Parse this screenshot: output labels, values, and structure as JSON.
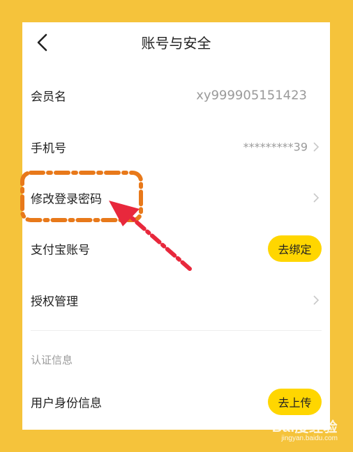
{
  "header": {
    "title": "账号与安全"
  },
  "rows": [
    {
      "label": "会员名",
      "value": "xy999905151423"
    },
    {
      "label": "手机号",
      "value": "*********39"
    },
    {
      "label": "修改登录密码"
    },
    {
      "label": "支付宝账号",
      "button": "去绑定"
    },
    {
      "label": "授权管理"
    }
  ],
  "section": {
    "title": "认证信息"
  },
  "identity_row": {
    "label": "用户身份信息",
    "button": "去上传"
  },
  "watermark": {
    "main": "Bai度经验",
    "sub": "jingyan.baidu.com"
  },
  "colors": {
    "background": "#f5c33b",
    "pill": "#ffd600",
    "annotation_box": "#e8791a",
    "annotation_arrow": "#e8283c"
  },
  "icons": [
    "back-arrow-icon",
    "chevron-right-icon"
  ]
}
